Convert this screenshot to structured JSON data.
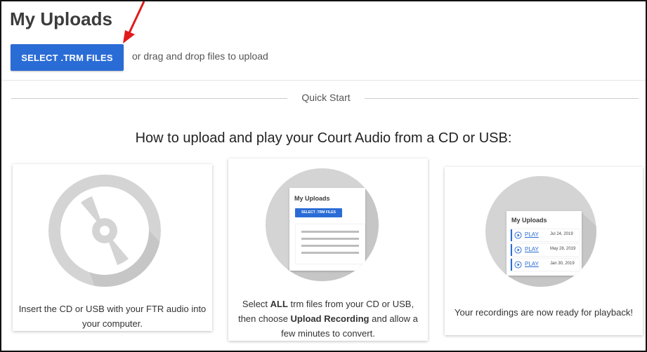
{
  "page": {
    "title": "My Uploads",
    "select_button": "SELECT .TRM FILES",
    "drag_text": "or drag and drop files to upload",
    "quick_start": "Quick Start",
    "heading": "How to upload and play your Court Audio from a CD or USB:"
  },
  "colors": {
    "accent": "#2a6cd6",
    "annotation_arrow": "#e01b1b"
  },
  "steps": [
    {
      "icon": "cd-icon",
      "caption": "Insert the CD or USB with your FTR audio into your computer."
    },
    {
      "icon": "upload-window-icon",
      "mini_title": "My Uploads",
      "mini_button": "SELECT .TRM FILES",
      "caption_1": "Select ",
      "caption_bold_1": "ALL",
      "caption_2": " trm files from your CD or USB, then choose ",
      "caption_bold_2": "Upload Recording",
      "caption_3": " and allow a few minutes to convert."
    },
    {
      "icon": "recordings-list-icon",
      "mini_title": "My Uploads",
      "recordings": [
        {
          "play_label": "PLAY",
          "date": "Jul 24, 2019"
        },
        {
          "play_label": "PLAY",
          "date": "May 28, 2019"
        },
        {
          "play_label": "PLAY",
          "date": "Jan 30, 2019"
        }
      ],
      "caption": "Your recordings are now ready for playback!"
    }
  ]
}
